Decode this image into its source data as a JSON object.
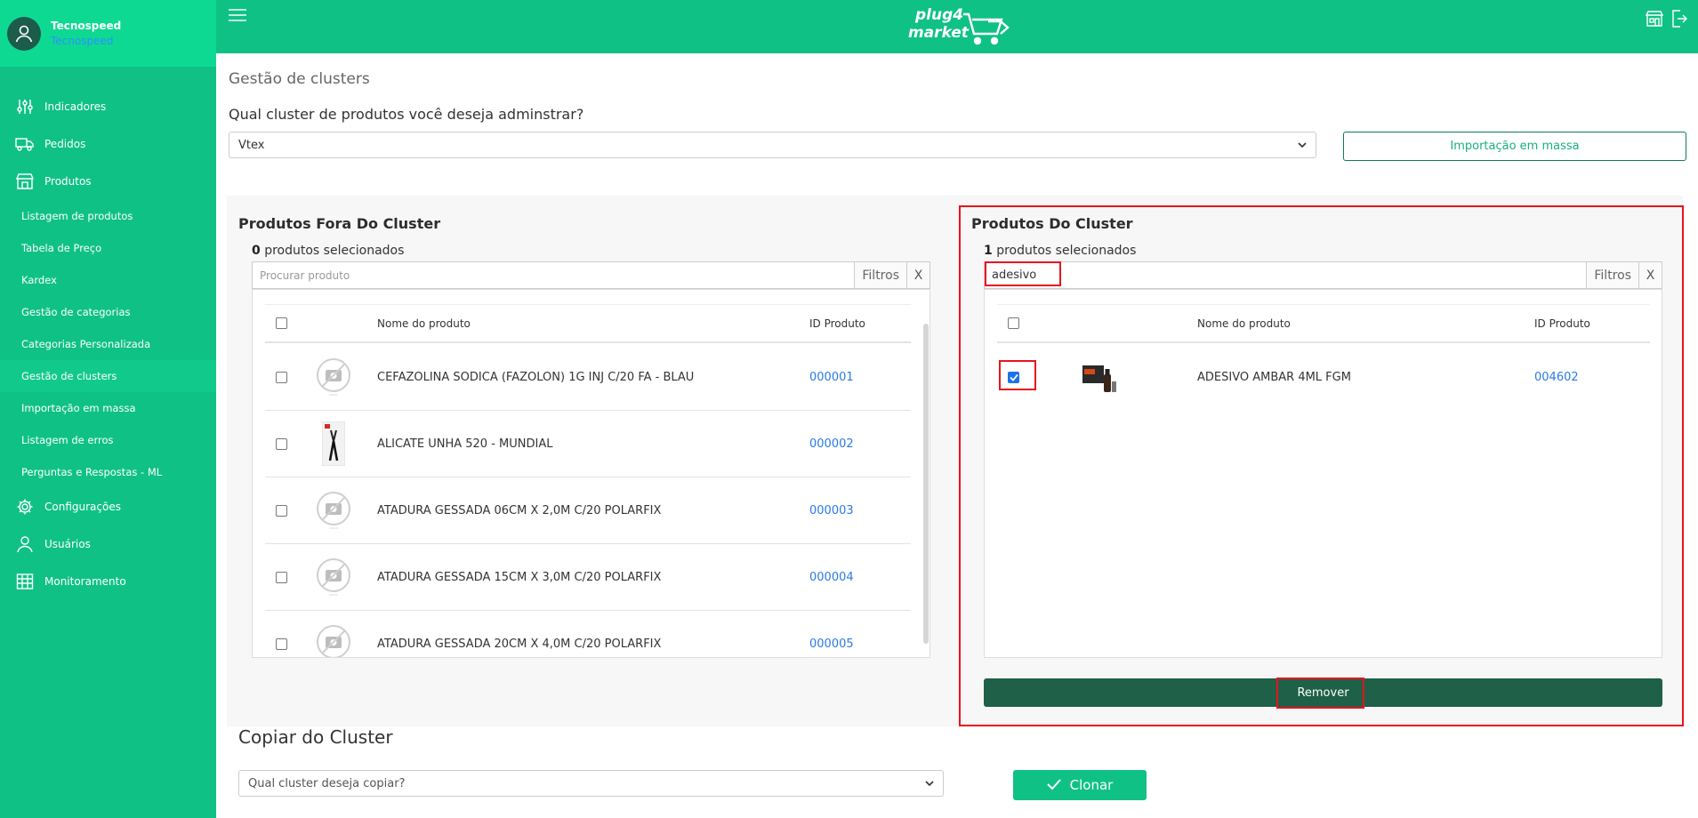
{
  "sidebar": {
    "user_name": "Tecnospeed",
    "user_company": "Tecnospeed",
    "items": [
      {
        "label": "Indicadores",
        "icon": "sliders-icon"
      },
      {
        "label": "Pedidos",
        "icon": "truck-icon"
      },
      {
        "label": "Produtos",
        "icon": "store-icon"
      }
    ],
    "subitems": [
      "Listagem de produtos",
      "Tabela de Preço",
      "Kardex",
      "Gestão de categorias",
      "Categorias Personalizada",
      "Gestão de clusters",
      "Importação em massa",
      "Listagem de erros",
      "Perguntas e Respostas - ML"
    ],
    "bottom_items": [
      {
        "label": "Configurações",
        "icon": "gear-icon"
      },
      {
        "label": "Usuários",
        "icon": "user-icon"
      },
      {
        "label": "Monitoramento",
        "icon": "building-icon"
      }
    ]
  },
  "header": {
    "logo_line1": "plug4",
    "logo_line2": "market"
  },
  "main": {
    "page_title": "Gestão de clusters",
    "question": "Qual cluster de produtos você deseja adminstrar?",
    "cluster_selected": "Vtex",
    "import_button": "Importação em massa"
  },
  "left_panel": {
    "title": "Produtos Fora Do Cluster",
    "selected_count": "0",
    "selected_suffix": " produtos selecionados",
    "search_placeholder": "Procurar produto",
    "filters_label": "Filtros",
    "clear_label": "X",
    "columns": [
      "Nome do produto",
      "ID Produto"
    ],
    "rows": [
      {
        "name": "CEFAZOLINA SODICA (FAZOLON) 1G INJ C/20 FA - BLAU",
        "id": "000001",
        "image": "no-image"
      },
      {
        "name": "ALICATE UNHA 520 - MUNDIAL",
        "id": "000002",
        "image": "pliers"
      },
      {
        "name": "ATADURA GESSADA 06CM X 2,0M C/20 POLARFIX",
        "id": "000003",
        "image": "no-image"
      },
      {
        "name": "ATADURA GESSADA 15CM X 3,0M C/20 POLARFIX",
        "id": "000004",
        "image": "no-image"
      },
      {
        "name": "ATADURA GESSADA 20CM X 4,0M C/20 POLARFIX",
        "id": "000005",
        "image": "no-image"
      }
    ]
  },
  "right_panel": {
    "title": "Produtos Do Cluster",
    "selected_count": "1",
    "selected_suffix": " produtos selecionados",
    "search_value": "adesivo",
    "filters_label": "Filtros",
    "clear_label": "X",
    "columns": [
      "Nome do produto",
      "ID Produto"
    ],
    "rows": [
      {
        "name": "ADESIVO AMBAR 4ML FGM",
        "id": "004602",
        "image": "adhesive-kit",
        "checked": true
      }
    ],
    "remove_button": "Remover"
  },
  "copy": {
    "title": "Copiar do Cluster",
    "select_placeholder": "Qual cluster deseja copiar?",
    "clone_button": "Clonar"
  },
  "colors": {
    "brand_green": "#0fc185",
    "dark_green": "#1e6048",
    "highlight_red": "#e8131d",
    "link_blue": "#2a7ae2"
  }
}
